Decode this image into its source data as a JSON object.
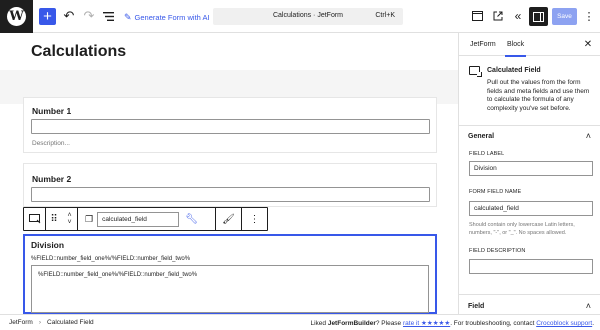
{
  "topbar": {
    "wp_logo": "W",
    "gen_ai_label": "Generate Form with AI",
    "command_bar_title": "Calculations · JetForm",
    "command_bar_shortcut": "Ctrl+K",
    "save_label": "Save"
  },
  "document": {
    "title": "Calculations",
    "fields": [
      {
        "label": "Number 1",
        "description": "Description..."
      },
      {
        "label": "Number 2"
      }
    ]
  },
  "block_toolbar": {
    "field_name_value": "calculated_field"
  },
  "selected_block": {
    "label": "Division",
    "formula_preview": "%FIELD::number_field_one%/%FIELD::number_field_two%",
    "formula_value": "%FIELD::number_field_one%/%FIELD::number_field_two%"
  },
  "sidebar": {
    "tabs": [
      "JetForm",
      "Block"
    ],
    "active_tab": "Block",
    "block_card": {
      "title": "Calculated Field",
      "description": "Pull out the values from the form fields and meta fields and use them to calculate the formula of any complexity you've set before."
    },
    "general_panel": {
      "title": "General",
      "field_label_label": "FIELD LABEL",
      "field_label_value": "Division",
      "form_field_name_label": "FORM FIELD NAME",
      "form_field_name_value": "calculated_field",
      "form_field_name_help": "Should contain only lowercase Latin letters, numbers, \"-\", or \"_\". No spaces allowed.",
      "field_description_label": "FIELD DESCRIPTION"
    },
    "field_panel": {
      "title": "Field"
    }
  },
  "footer": {
    "breadcrumb": [
      "JetForm",
      "Calculated Field"
    ],
    "liked_prefix": "Liked ",
    "brand": "JetFormBuilder",
    "please": "? Please ",
    "rate_link": "rate it ★★★★★",
    "support_prefix": ". For troubleshooting, contact ",
    "support_link": "Crocoblock support",
    "support_suffix": "."
  }
}
